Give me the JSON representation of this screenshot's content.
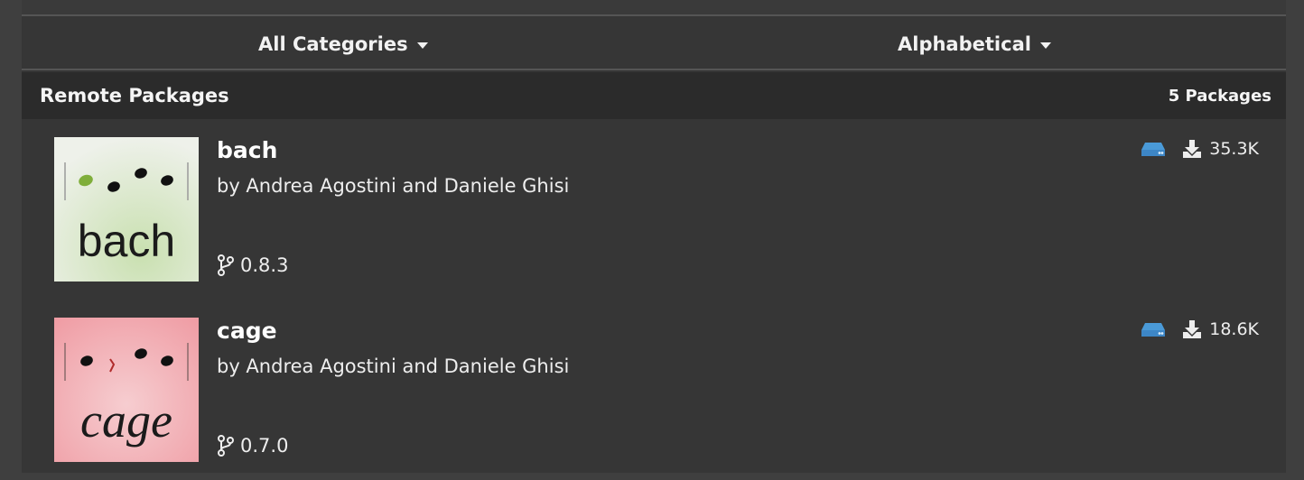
{
  "filters": {
    "category_label": "All Categories",
    "sort_label": "Alphabetical"
  },
  "section": {
    "title": "Remote Packages",
    "count_label": "5 Packages"
  },
  "packages": [
    {
      "name": "bach",
      "author": "by Andrea Agostini and Daniele Ghisi",
      "version": "0.8.3",
      "downloads": "35.3K",
      "thumbnail_word": "bach",
      "storage_icon": "drive-icon",
      "download_icon": "download-icon",
      "version_icon": "branch-icon"
    },
    {
      "name": "cage",
      "author": "by Andrea Agostini and Daniele Ghisi",
      "version": "0.7.0",
      "downloads": "18.6K",
      "thumbnail_word": "cage",
      "storage_icon": "drive-icon",
      "download_icon": "download-icon",
      "version_icon": "branch-icon"
    }
  ],
  "colors": {
    "background": "#363636",
    "header": "#2b2b2b",
    "accent_drive": "#4a9ad8",
    "bach_thumb": "#e9eee0",
    "cage_thumb": "#f3c3c6"
  }
}
